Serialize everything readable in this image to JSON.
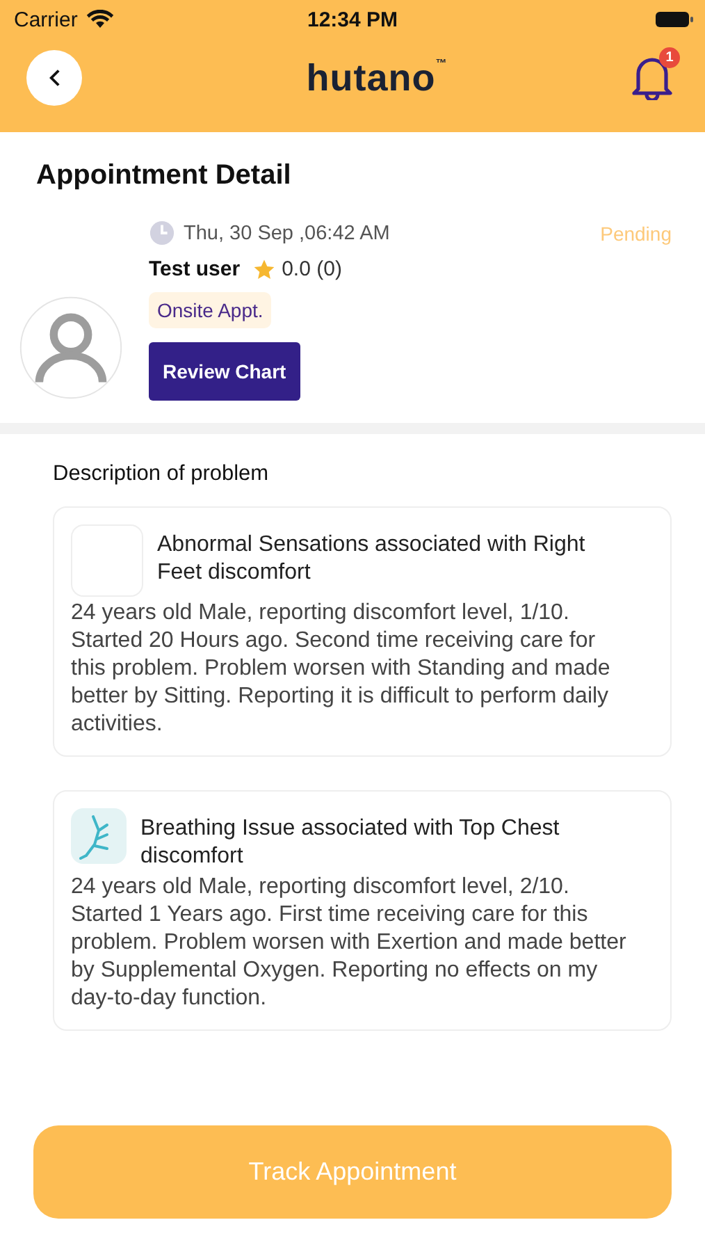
{
  "status_bar": {
    "carrier": "Carrier",
    "time": "12:34 PM"
  },
  "header": {
    "logo": "hutano",
    "trademark": "™",
    "notification_count": "1"
  },
  "page_title": "Appointment Detail",
  "appointment": {
    "datetime": "Thu, 30 Sep ,06:42 AM",
    "status": "Pending",
    "name": "Test  user",
    "rating": "0.0 (0)",
    "type": "Onsite Appt.",
    "review_button": "Review Chart"
  },
  "problems_section": {
    "title": "Description of problem",
    "problems": [
      {
        "kind": "blank",
        "title": "Abnormal Sensations associated with Right Feet discomfort",
        "description": "24 years old Male, reporting discomfort level, 1/10. Started 20 Hours ago. Second time receiving care for this problem. Problem worsen with Standing  and made better by Sitting. Reporting it is difficult to perform daily activities."
      },
      {
        "kind": "lungs",
        "title": "Breathing Issue associated with Top Chest discomfort",
        "description": "24 years old Male, reporting discomfort level, 2/10. Started 1 Years ago. First time receiving care for this problem. Problem worsen with Exertion and made better by Supplemental Oxygen. Reporting no effects on my day-to-day function."
      }
    ]
  },
  "track_button": "Track Appointment"
}
